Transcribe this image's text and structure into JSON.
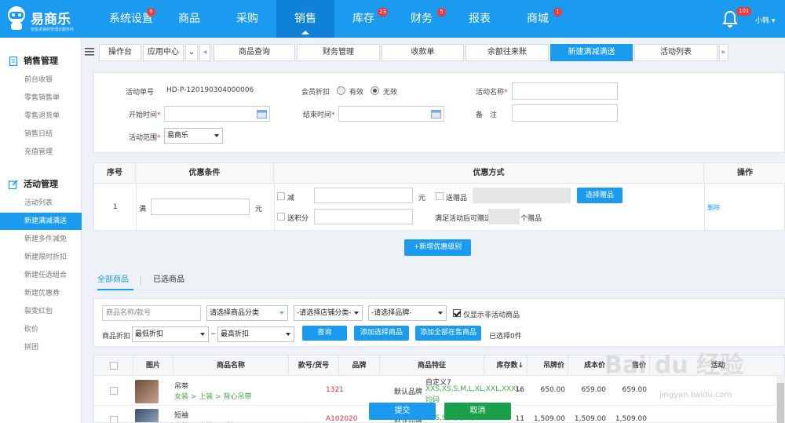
{
  "brand": {
    "name": "易商乐",
    "subtitle": "智能进销存管理云服务商"
  },
  "nav": [
    {
      "label": "系统设置",
      "badge": "9"
    },
    {
      "label": "商品",
      "badge": ""
    },
    {
      "label": "采购",
      "badge": ""
    },
    {
      "label": "销售",
      "badge": "",
      "active": true
    },
    {
      "label": "库存",
      "badge": "23"
    },
    {
      "label": "财务",
      "badge": "5"
    },
    {
      "label": "报表",
      "badge": ""
    },
    {
      "label": "商城",
      "badge": "1"
    }
  ],
  "header": {
    "notify_count": "101",
    "user": "小韩"
  },
  "sidebar": {
    "group1": "销售管理",
    "group1_items": [
      "前台收银",
      "零售销售单",
      "零售退货单",
      "销售日结",
      "充值管理"
    ],
    "group2": "活动管理",
    "group2_items": [
      "活动列表",
      "新建满减满送",
      "新建多件减免",
      "新建限时折扣",
      "新建任选组合",
      "新建优惠券",
      "裂变红包",
      "砍价",
      "拼团"
    ]
  },
  "tabs": {
    "workbench": "操作台",
    "appcenter": "应用中心",
    "items": [
      "商品查询",
      "财务管理",
      "收款单",
      "余额往来账",
      "新建满减满送",
      "活动列表"
    ],
    "active_index": 4
  },
  "form": {
    "order_no_label": "活动单号",
    "order_no": "HD-P-120190304000006",
    "member_discount_label": "会员折扣",
    "opt_valid": "有效",
    "opt_invalid": "无效",
    "activity_name_label": "活动名称",
    "start_time_label": "开始时间",
    "end_time_label": "结束时间",
    "remark_label": "备　注",
    "scope_label": "活动范围",
    "scope_value": "易商乐"
  },
  "discount": {
    "headers": [
      "序号",
      "优惠条件",
      "优惠方式",
      "操作"
    ],
    "row_no": "1",
    "full_prefix": "满",
    "unit_yuan": "元",
    "reduce_label": "减",
    "gift_label": "送赠品",
    "choose_gift_button": "选择赠品",
    "points_label": "送积分",
    "gift_count_prefix": "满足活动后可赠送",
    "gift_count_suffix": "个赠品",
    "delete_link": "删除",
    "add_level_button": "+新增优惠级别"
  },
  "product_tabs": [
    "全部商品",
    "已选商品"
  ],
  "filters": {
    "search_placeholder": "商品名称/款号",
    "category": "请选择商品分类",
    "store_category": "-请选择店铺分类-",
    "brand": "-请选择品牌-",
    "only_inactive": "仅显示非活动商品",
    "discount_label": "商品折扣",
    "min_discount": "最低折扣",
    "max_discount": "最高折扣",
    "tilde": "~",
    "query_button": "查询",
    "add_selected_button": "添加选择商品",
    "add_all_button": "添加全部在售商品",
    "selected_count": "已选择0件"
  },
  "table": {
    "headers": [
      "图片",
      "商品名称",
      "款号/货号",
      "品牌",
      "商品特征",
      "库存数↓",
      "吊牌价",
      "成本价",
      "售价",
      "活动"
    ],
    "rows": [
      {
        "name": "吊带",
        "path": "女装 > 上装 > 背心吊带",
        "code": "1321",
        "brand": "默认品牌",
        "feature1": "自定义7",
        "feature2": "XXS,XS,S,M,L,XL,XXL,XXXL,",
        "feature3": "均码",
        "stock": "16",
        "tag_price": "650.00",
        "cost": "659.00",
        "price": "659.00"
      },
      {
        "name": "短袖",
        "path": "女装 > 上装 > T恤",
        "code": "A102020",
        "brand": "默认品牌",
        "feature1": "色",
        "feature2": "XXS,S,M,L,XL,XXL",
        "feature3": "",
        "stock": "11",
        "tag_price": "1,509.00",
        "cost": "1,509.00",
        "price": "1,509.00"
      }
    ]
  },
  "footer": {
    "submit": "提交",
    "cancel": "取消"
  },
  "watermark": {
    "text": "Bai du 经验",
    "url": "jingyan.baidu.com"
  },
  "colors": {
    "primary": "#1a9bf0",
    "active_nav": "#0f82d8",
    "badge": "#f2383b",
    "cancel": "#1aa04a",
    "link_green": "#46a846",
    "code_red": "#d9333a"
  }
}
